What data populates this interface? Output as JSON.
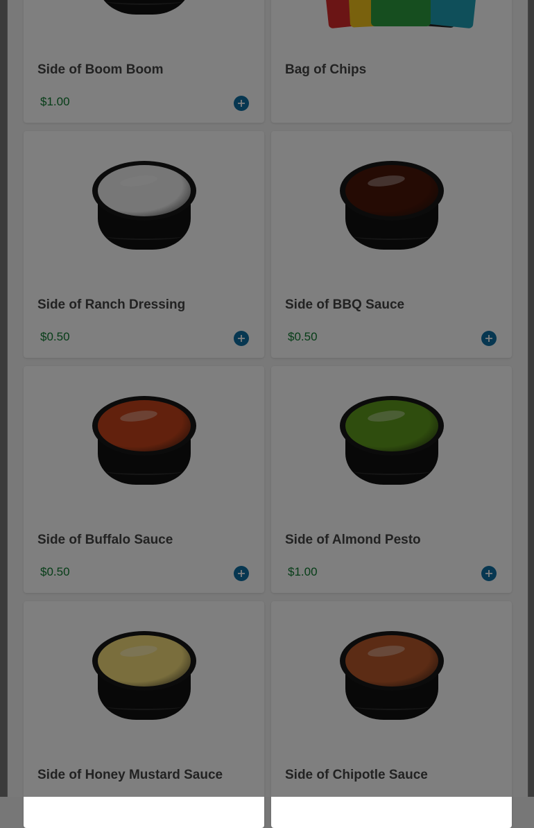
{
  "products": [
    {
      "name": "Side of Boom Boom",
      "price": "$1.00",
      "image": "sauce-cup",
      "sauce_color": "#d9a07a",
      "add_label": "add-to-cart-icon"
    },
    {
      "name": "Bag of Chips",
      "price": "",
      "image": "chip-bags",
      "add_label": ""
    },
    {
      "name": "Side of Ranch Dressing",
      "price": "$0.50",
      "image": "sauce-cup",
      "sauce_color": "#eeeeee",
      "add_label": "add-to-cart-icon"
    },
    {
      "name": "Side of BBQ Sauce",
      "price": "$0.50",
      "image": "sauce-cup",
      "sauce_color": "#4a1608",
      "add_label": "add-to-cart-icon"
    },
    {
      "name": "Side of Buffalo Sauce",
      "price": "$0.50",
      "image": "sauce-cup",
      "sauce_color": "#c4431a",
      "add_label": "add-to-cart-icon"
    },
    {
      "name": "Side of Almond Pesto",
      "price": "$1.00",
      "image": "sauce-cup",
      "sauce_color": "#5f9a1c",
      "add_label": "add-to-cart-icon"
    },
    {
      "name": "Side of Honey Mustard Sauce",
      "price": "",
      "image": "sauce-cup",
      "sauce_color": "#f4dd7a",
      "add_label": ""
    },
    {
      "name": "Side of Chipotle Sauce",
      "price": "",
      "image": "sauce-cup",
      "sauce_color": "#b8582a",
      "add_label": ""
    }
  ],
  "colors": {
    "price": "#0d7a2f",
    "add_button": "#0f6fa3",
    "overlay": "rgba(0,0,0,0.5)"
  },
  "chip_bag_colors": [
    "#d62a2a",
    "#f2c21b",
    "#2c9c3f",
    "#222222",
    "#1f9fb5"
  ]
}
